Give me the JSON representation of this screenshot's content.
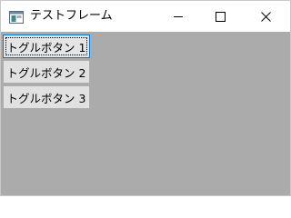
{
  "window": {
    "title": "テストフレーム",
    "icon": "java-frame-icon",
    "controls": {
      "minimize_icon": "minimize-icon",
      "maximize_icon": "maximize-icon",
      "close_icon": "close-icon"
    }
  },
  "toggle_buttons": [
    {
      "label": "トグルボタン 1"
    },
    {
      "label": "トグルボタン 2"
    },
    {
      "label": "トグルボタン 3"
    }
  ],
  "colors": {
    "content_background": "#ababab",
    "button_face": "#e1e1e1",
    "button_border": "#adadad",
    "focus_border": "#0078d7"
  }
}
